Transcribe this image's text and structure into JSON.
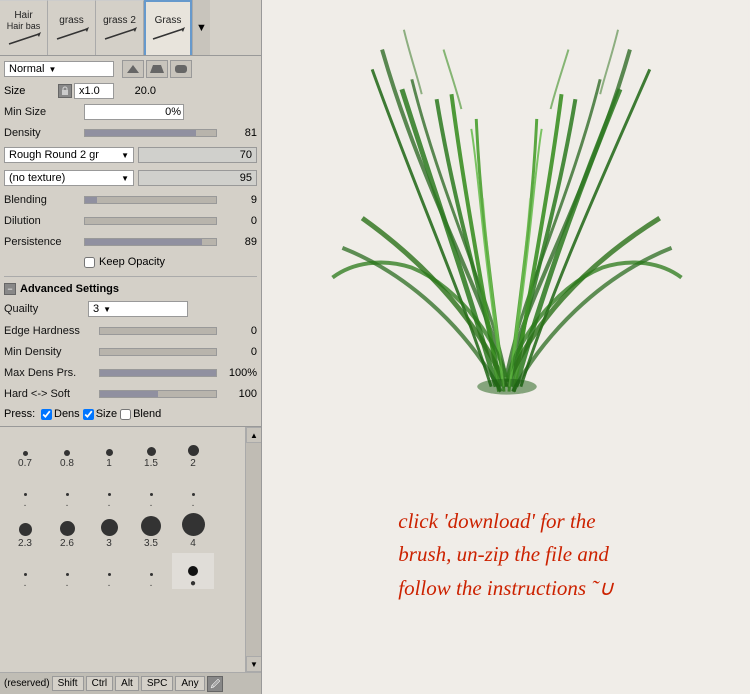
{
  "brushTabs": {
    "tabs": [
      {
        "label": "Hair",
        "sublabel": "Hair bas",
        "icon": "✏"
      },
      {
        "label": "grass",
        "sublabel": "",
        "icon": "✒"
      },
      {
        "label": "grass 2",
        "sublabel": "",
        "icon": "✒"
      },
      {
        "label": "Grass",
        "sublabel": "",
        "icon": "✒",
        "active": true
      }
    ],
    "arrowLabel": "▼"
  },
  "modeDropdown": {
    "value": "Normal",
    "arrow": "▼"
  },
  "shapes": [
    "▲",
    "▲",
    "▲"
  ],
  "size": {
    "label": "Size",
    "multiplier": "x1.0",
    "value": "20.0"
  },
  "minSize": {
    "label": "Min Size",
    "value": "0%"
  },
  "density": {
    "label": "Density",
    "value": "81",
    "fillPct": 85
  },
  "roughRound": {
    "label": "Rough Round 2 gr",
    "value": "70",
    "fillPct": 70
  },
  "noTexture": {
    "label": "(no texture)",
    "value": "95",
    "fillPct": 95
  },
  "blending": {
    "label": "Blending",
    "value": "9",
    "fillPct": 9
  },
  "dilution": {
    "label": "Dilution",
    "value": "0",
    "fillPct": 0
  },
  "persistence": {
    "label": "Persistence",
    "value": "89",
    "fillPct": 89
  },
  "keepOpacity": {
    "label": "Keep Opacity",
    "checked": false
  },
  "advanced": {
    "label": "Advanced Settings",
    "quality": {
      "label": "Quailty",
      "value": "3"
    },
    "edgeHardness": {
      "label": "Edge Hardness",
      "value": "0",
      "fillPct": 0
    },
    "minDensity": {
      "label": "Min Density",
      "value": "0",
      "fillPct": 0
    },
    "maxDensPrs": {
      "label": "Max Dens Prs.",
      "value": "100%",
      "fillPct": 100
    },
    "hardSoft": {
      "label": "Hard <-> Soft",
      "value": "100",
      "fillPct": 50
    }
  },
  "press": {
    "label": "Press:",
    "dens": {
      "label": "Dens",
      "checked": true
    },
    "size": {
      "label": "Size",
      "checked": true
    },
    "blend": {
      "label": "Blend",
      "checked": false
    }
  },
  "dotRows": [
    {
      "values": [
        "0.7",
        "0.8",
        "1",
        "1.5",
        "2"
      ],
      "sizes": [
        3,
        4,
        5,
        7,
        9
      ]
    },
    {
      "values": [
        ".",
        ".",
        ".",
        ".",
        "."
      ],
      "sizes": [
        2,
        2,
        2,
        2,
        2
      ]
    },
    {
      "values": [
        "2.3",
        "2.6",
        "3",
        "3.5",
        "4"
      ],
      "sizes": [
        10,
        11,
        13,
        15,
        18
      ]
    },
    {
      "values": [
        ".",
        ".",
        ".",
        ".",
        "●"
      ],
      "sizes": [
        2,
        2,
        2,
        2,
        8
      ]
    }
  ],
  "bottomBar": {
    "reserved": "(reserved)",
    "btns": [
      "Shift",
      "Ctrl",
      "Alt",
      "SPC",
      "Any"
    ]
  },
  "handwrittenText": "click 'download' for the\nbrush, un-zip the file and\nfollow the instructions ˜∪"
}
